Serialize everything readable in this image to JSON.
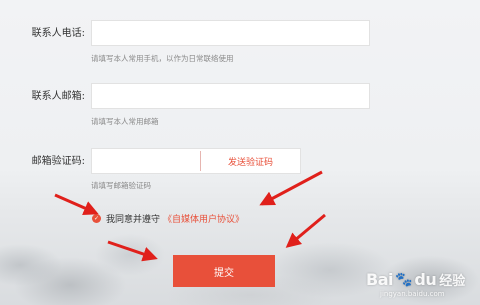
{
  "form": {
    "phone": {
      "label": "联系人电话:",
      "value": "",
      "hint": "请填写本人常用手机，以作为日常联络使用"
    },
    "email": {
      "label": "联系人邮箱:",
      "value": "",
      "hint": "请填写本人常用邮箱"
    },
    "code": {
      "label": "邮箱验证码:",
      "value": "",
      "hint": "请填写邮箱验证码",
      "send_label": "发送验证码"
    },
    "agreement": {
      "checkmark": "✓",
      "text": "我同意并遵守",
      "link": "《自媒体用户协议》",
      "checked": true
    },
    "submit_label": "提交"
  },
  "watermark": {
    "brand": "Bai",
    "paw": "🐾",
    "brand2": "du",
    "jingyan": "经验",
    "url": "jingyan.baidu.com"
  },
  "colors": {
    "accent": "#e8503a",
    "arrow": "#e0201b"
  },
  "icons": [
    "check-icon",
    "annotation-arrow",
    "baidu-paw-icon"
  ]
}
